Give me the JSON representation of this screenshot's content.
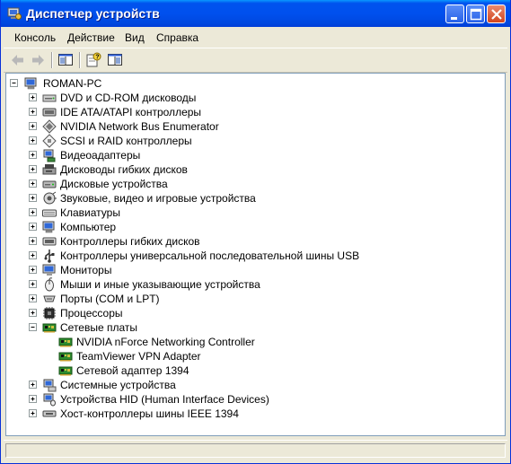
{
  "window": {
    "title": "Диспетчер устройств"
  },
  "menu": [
    "Консоль",
    "Действие",
    "Вид",
    "Справка"
  ],
  "tree": {
    "root": "ROMAN-PC",
    "categories": [
      {
        "label": "DVD и CD-ROM дисководы",
        "icon": "dvd-drive-icon",
        "expanded": false
      },
      {
        "label": "IDE ATA/ATAPI контроллеры",
        "icon": "ide-controller-icon",
        "expanded": false
      },
      {
        "label": "NVIDIA Network Bus Enumerator",
        "icon": "bus-enumerator-icon",
        "expanded": false
      },
      {
        "label": "SCSI и RAID контроллеры",
        "icon": "scsi-controller-icon",
        "expanded": false
      },
      {
        "label": "Видеоадаптеры",
        "icon": "video-adapter-icon",
        "expanded": false
      },
      {
        "label": "Дисководы гибких дисков",
        "icon": "floppy-drive-icon",
        "expanded": false
      },
      {
        "label": "Дисковые устройства",
        "icon": "disk-drive-icon",
        "expanded": false
      },
      {
        "label": "Звуковые, видео и игровые устройства",
        "icon": "sound-device-icon",
        "expanded": false
      },
      {
        "label": "Клавиатуры",
        "icon": "keyboard-icon",
        "expanded": false
      },
      {
        "label": "Компьютер",
        "icon": "computer-icon",
        "expanded": false
      },
      {
        "label": "Контроллеры гибких дисков",
        "icon": "floppy-controller-icon",
        "expanded": false
      },
      {
        "label": "Контроллеры универсальной последовательной шины USB",
        "icon": "usb-controller-icon",
        "expanded": false
      },
      {
        "label": "Мониторы",
        "icon": "monitor-icon",
        "expanded": false
      },
      {
        "label": "Мыши и иные указывающие устройства",
        "icon": "mouse-icon",
        "expanded": false
      },
      {
        "label": "Порты (COM и LPT)",
        "icon": "port-icon",
        "expanded": false
      },
      {
        "label": "Процессоры",
        "icon": "processor-icon",
        "expanded": false
      },
      {
        "label": "Сетевые платы",
        "icon": "network-adapter-icon",
        "expanded": true,
        "children": [
          {
            "label": "NVIDIA nForce Networking Controller",
            "icon": "network-card-icon"
          },
          {
            "label": "TeamViewer VPN Adapter",
            "icon": "network-card-icon"
          },
          {
            "label": "Сетевой адаптер 1394",
            "icon": "network-card-icon"
          }
        ]
      },
      {
        "label": "Системные устройства",
        "icon": "system-device-icon",
        "expanded": false
      },
      {
        "label": "Устройства HID (Human Interface Devices)",
        "icon": "hid-device-icon",
        "expanded": false
      },
      {
        "label": "Хост-контроллеры шины IEEE 1394",
        "icon": "ieee1394-controller-icon",
        "expanded": false
      }
    ]
  }
}
